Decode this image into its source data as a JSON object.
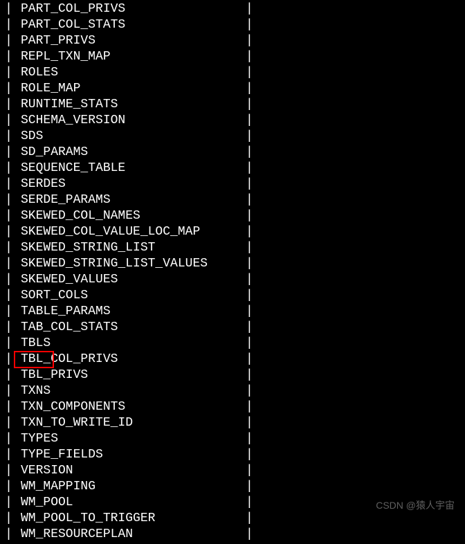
{
  "rows": [
    "PART_COL_PRIVS",
    "PART_COL_STATS",
    "PART_PRIVS",
    "REPL_TXN_MAP",
    "ROLES",
    "ROLE_MAP",
    "RUNTIME_STATS",
    "SCHEMA_VERSION",
    "SDS",
    "SD_PARAMS",
    "SEQUENCE_TABLE",
    "SERDES",
    "SERDE_PARAMS",
    "SKEWED_COL_NAMES",
    "SKEWED_COL_VALUE_LOC_MAP",
    "SKEWED_STRING_LIST",
    "SKEWED_STRING_LIST_VALUES",
    "SKEWED_VALUES",
    "SORT_COLS",
    "TABLE_PARAMS",
    "TAB_COL_STATS",
    "TBLS",
    "TBL_COL_PRIVS",
    "TBL_PRIVS",
    "TXNS",
    "TXN_COMPONENTS",
    "TXN_TO_WRITE_ID",
    "TYPES",
    "TYPE_FIELDS",
    "VERSION",
    "WM_MAPPING",
    "WM_POOL",
    "WM_POOL_TO_TRIGGER",
    "WM_RESOURCEPLAN"
  ],
  "separator": "|",
  "highlighted_index": 21,
  "watermark": "CSDN @猿人宇宙"
}
